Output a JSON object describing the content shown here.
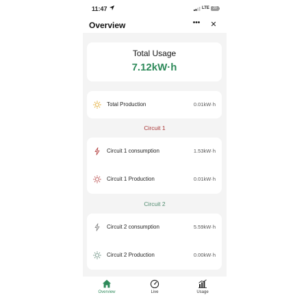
{
  "status_bar": {
    "time": "11:47",
    "network": "LTE",
    "battery": "20"
  },
  "header": {
    "title": "Overview",
    "more_label": "•••",
    "close_label": "✕"
  },
  "usage": {
    "label": "Total Usage",
    "value": "7.12kW·h"
  },
  "total_production": {
    "label": "Total Production",
    "value": "0.01kW·h"
  },
  "circuit1": {
    "title": "Circuit 1",
    "consumption": {
      "label": "Circuit 1 consumption",
      "value": "1.53kW·h"
    },
    "production": {
      "label": "Circuit 1 Production",
      "value": "0.01kW·h"
    }
  },
  "circuit2": {
    "title": "Circuit 2",
    "consumption": {
      "label": "Circuit 2 consumption",
      "value": "5.59kW·h"
    },
    "production": {
      "label": "Circuit 2 Production",
      "value": "0.00kW·h"
    }
  },
  "tabs": [
    {
      "label": "Overview",
      "icon": "home-icon",
      "active": true
    },
    {
      "label": "Live",
      "icon": "gauge-icon",
      "active": false
    },
    {
      "label": "Usage",
      "icon": "bar-chart-icon",
      "active": false
    }
  ],
  "colors": {
    "accent_green": "#2e8a5a",
    "circuit1_red": "#a83232",
    "circuit2_green": "#4f8a6e",
    "sun_yellow": "#e0a62a",
    "background": "#f4f4f4"
  }
}
